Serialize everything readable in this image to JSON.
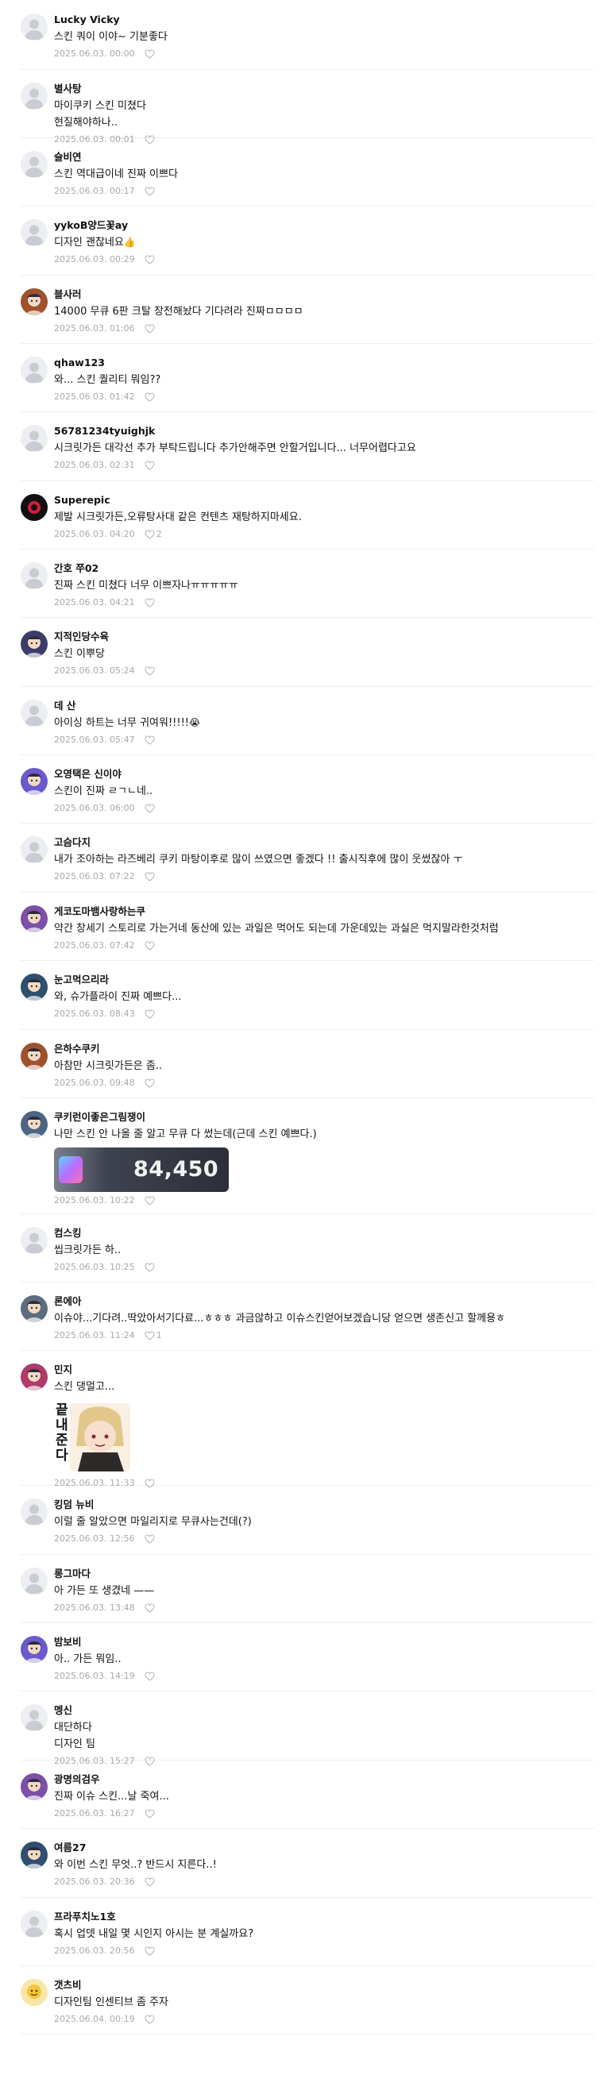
{
  "comments": [
    {
      "author": "Lucky Vicky",
      "lines": [
        "스킨 쿼이 이야~ 기분좋다"
      ],
      "date": "2025.06.03. 00:00",
      "likes": ""
    },
    {
      "author": "별사탕",
      "lines": [
        "마이쿠키 스킨 미쳤다",
        "현질해야하나.."
      ],
      "date": "2025.06.03. 00:01",
      "likes": ""
    },
    {
      "author": "슬비연",
      "lines": [
        "스킨 역대급이네 진짜 이쁘다"
      ],
      "date": "2025.06.03. 00:17",
      "likes": ""
    },
    {
      "author": "yykoB양드꽃ay",
      "lines": [
        "디자인 괜찮네요"
      ],
      "emoji": "👍",
      "date": "2025.06.03. 00:29",
      "likes": ""
    },
    {
      "author": "블사러",
      "lines": [
        "14000 무큐 6판 크탈 장전해놨다 기다려라 진짜ㅁㅁㅁㅁ"
      ],
      "date": "2025.06.03. 01:06",
      "likes": ""
    },
    {
      "author": "qhaw123",
      "lines": [
        "와... 스킨 퀄리티 뭐임??"
      ],
      "date": "2025.06.03. 01:42",
      "likes": ""
    },
    {
      "author": "56781234tyuighjk",
      "lines": [
        "시크릿가든 대각선 추가 부탁드립니다 추가안해주면 안할거입니다... 너무어렵다고요"
      ],
      "date": "2025.06.03. 02:31",
      "likes": ""
    },
    {
      "author": "Superepic",
      "lines": [
        "제발 시크릿가든,오류탕사대 같은 컨텐츠 재탕하지마세요."
      ],
      "date": "2025.06.03. 04:20",
      "likes": "2"
    },
    {
      "author": "간호 쭈02",
      "lines": [
        "진짜 스킨 미쳤다 너무 이쁘자나ㅠㅠㅠㅠㅠ"
      ],
      "date": "2025.06.03. 04:21",
      "likes": ""
    },
    {
      "author": "지적인당수육",
      "lines": [
        "스킨 이뿌당"
      ],
      "date": "2025.06.03. 05:24",
      "likes": ""
    },
    {
      "author": "데 산",
      "lines": [
        "아이싱 하트는 너무 귀여워!!!!!"
      ],
      "emoji": "😭",
      "date": "2025.06.03. 05:47",
      "likes": ""
    },
    {
      "author": "오영택은 신이야",
      "lines": [
        "스킨이 진짜 ㄹㄱㄴ네.."
      ],
      "date": "2025.06.03. 06:00",
      "likes": ""
    },
    {
      "author": "고슴다지",
      "lines": [
        "내가 조아하는 라즈베리 쿠키 마탕이후로 많이 쓰였으면 좋겠다 !! 출시직후에 많이 웃썼잖아 ㅜ"
      ],
      "date": "2025.06.03. 07:22",
      "likes": ""
    },
    {
      "author": "게코도마뱀사랑하는쿠",
      "lines": [
        "약간 창세기 스토리로 가는거네 동산에 있는 과일은 먹어도 되는데 가운데있는 과실은 먹지말라한것처럼"
      ],
      "date": "2025.06.03. 07:42",
      "likes": ""
    },
    {
      "author": "눈고먹으리라",
      "lines": [
        "와, 슈가플라이 진짜 예쁘다..."
      ],
      "date": "2025.06.03. 08:43",
      "likes": ""
    },
    {
      "author": "은하수쿠키",
      "lines": [
        "아참만 시크릿가든은 좀.."
      ],
      "date": "2025.06.03. 09:48",
      "likes": ""
    },
    {
      "author": "쿠키런이좋은그림쟁이",
      "lines": [
        "나만 스킨 안 나올 줄 알고 무큐 다 썼는데(근데 스킨 예쁘다.)"
      ],
      "attachment": {
        "type": "balance",
        "text": "84,450"
      },
      "date": "2025.06.03. 10:22",
      "likes": ""
    },
    {
      "author": "컴스킹",
      "lines": [
        "씹크릿가든 하.."
      ],
      "date": "2025.06.03. 10:25",
      "likes": ""
    },
    {
      "author": "론에아",
      "lines": [
        "이슈야...기다려..딱았아서기다료...ㅎㅎㅎ 과금않하고 이슈스킨얻어보겠습니당 얻으면 생존신고 할께용ㅎ"
      ],
      "date": "2025.06.03. 11:24",
      "likes": "1"
    },
    {
      "author": "민지",
      "lines": [
        "스킨 댕멀고..."
      ],
      "attachment": {
        "type": "sticker",
        "text": "끝내준다"
      },
      "date": "2025.06.03. 11:33",
      "likes": ""
    },
    {
      "author": "킹덤 뉴비",
      "lines": [
        "이럴 줄 알았으면 마일리지로 무큐사는건데(?)"
      ],
      "date": "2025.06.03. 12:56",
      "likes": ""
    },
    {
      "author": "롱그마다",
      "lines": [
        "아 가든 또 생겼네 ——"
      ],
      "date": "2025.06.03. 13:48",
      "likes": ""
    },
    {
      "author": "밤보비",
      "lines": [
        "아.. 가든 뭐임.."
      ],
      "date": "2025.06.03. 14:19",
      "likes": ""
    },
    {
      "author": "멩신",
      "lines": [
        "대단하다",
        "디자인 팀"
      ],
      "date": "2025.06.03. 15:27",
      "likes": ""
    },
    {
      "author": "광명의검우",
      "lines": [
        "진짜 이슈 스킨...날 죽여..."
      ],
      "date": "2025.06.03. 16:27",
      "likes": ""
    },
    {
      "author": "여름27",
      "lines": [
        "와 이번 스킨 무엇..? 반드시 지른다..!"
      ],
      "date": "2025.06.03. 20:36",
      "likes": ""
    },
    {
      "author": "프라푸치노1호",
      "lines": [
        "혹시 업뎃 내일 몇 시인지 아시는 분 계실까요?"
      ],
      "date": "2025.06.03. 20:56",
      "likes": ""
    },
    {
      "author": "갯츠비",
      "lines": [
        "디자인팀 인센티브 좀 주자"
      ],
      "date": "2025.06.04. 00:19",
      "likes": ""
    }
  ],
  "avatars": [
    "default",
    "default",
    "default",
    "default",
    "character",
    "default",
    "default",
    "black",
    "default",
    "character",
    "default",
    "character",
    "default",
    "character",
    "character",
    "character",
    "character",
    "default",
    "character",
    "character",
    "default",
    "default",
    "character",
    "default",
    "character",
    "character",
    "default",
    "yellow"
  ],
  "colors": {
    "meta": "#a9a9a9",
    "divider": "#eeeeee",
    "avatar_default": "#eceef1"
  }
}
